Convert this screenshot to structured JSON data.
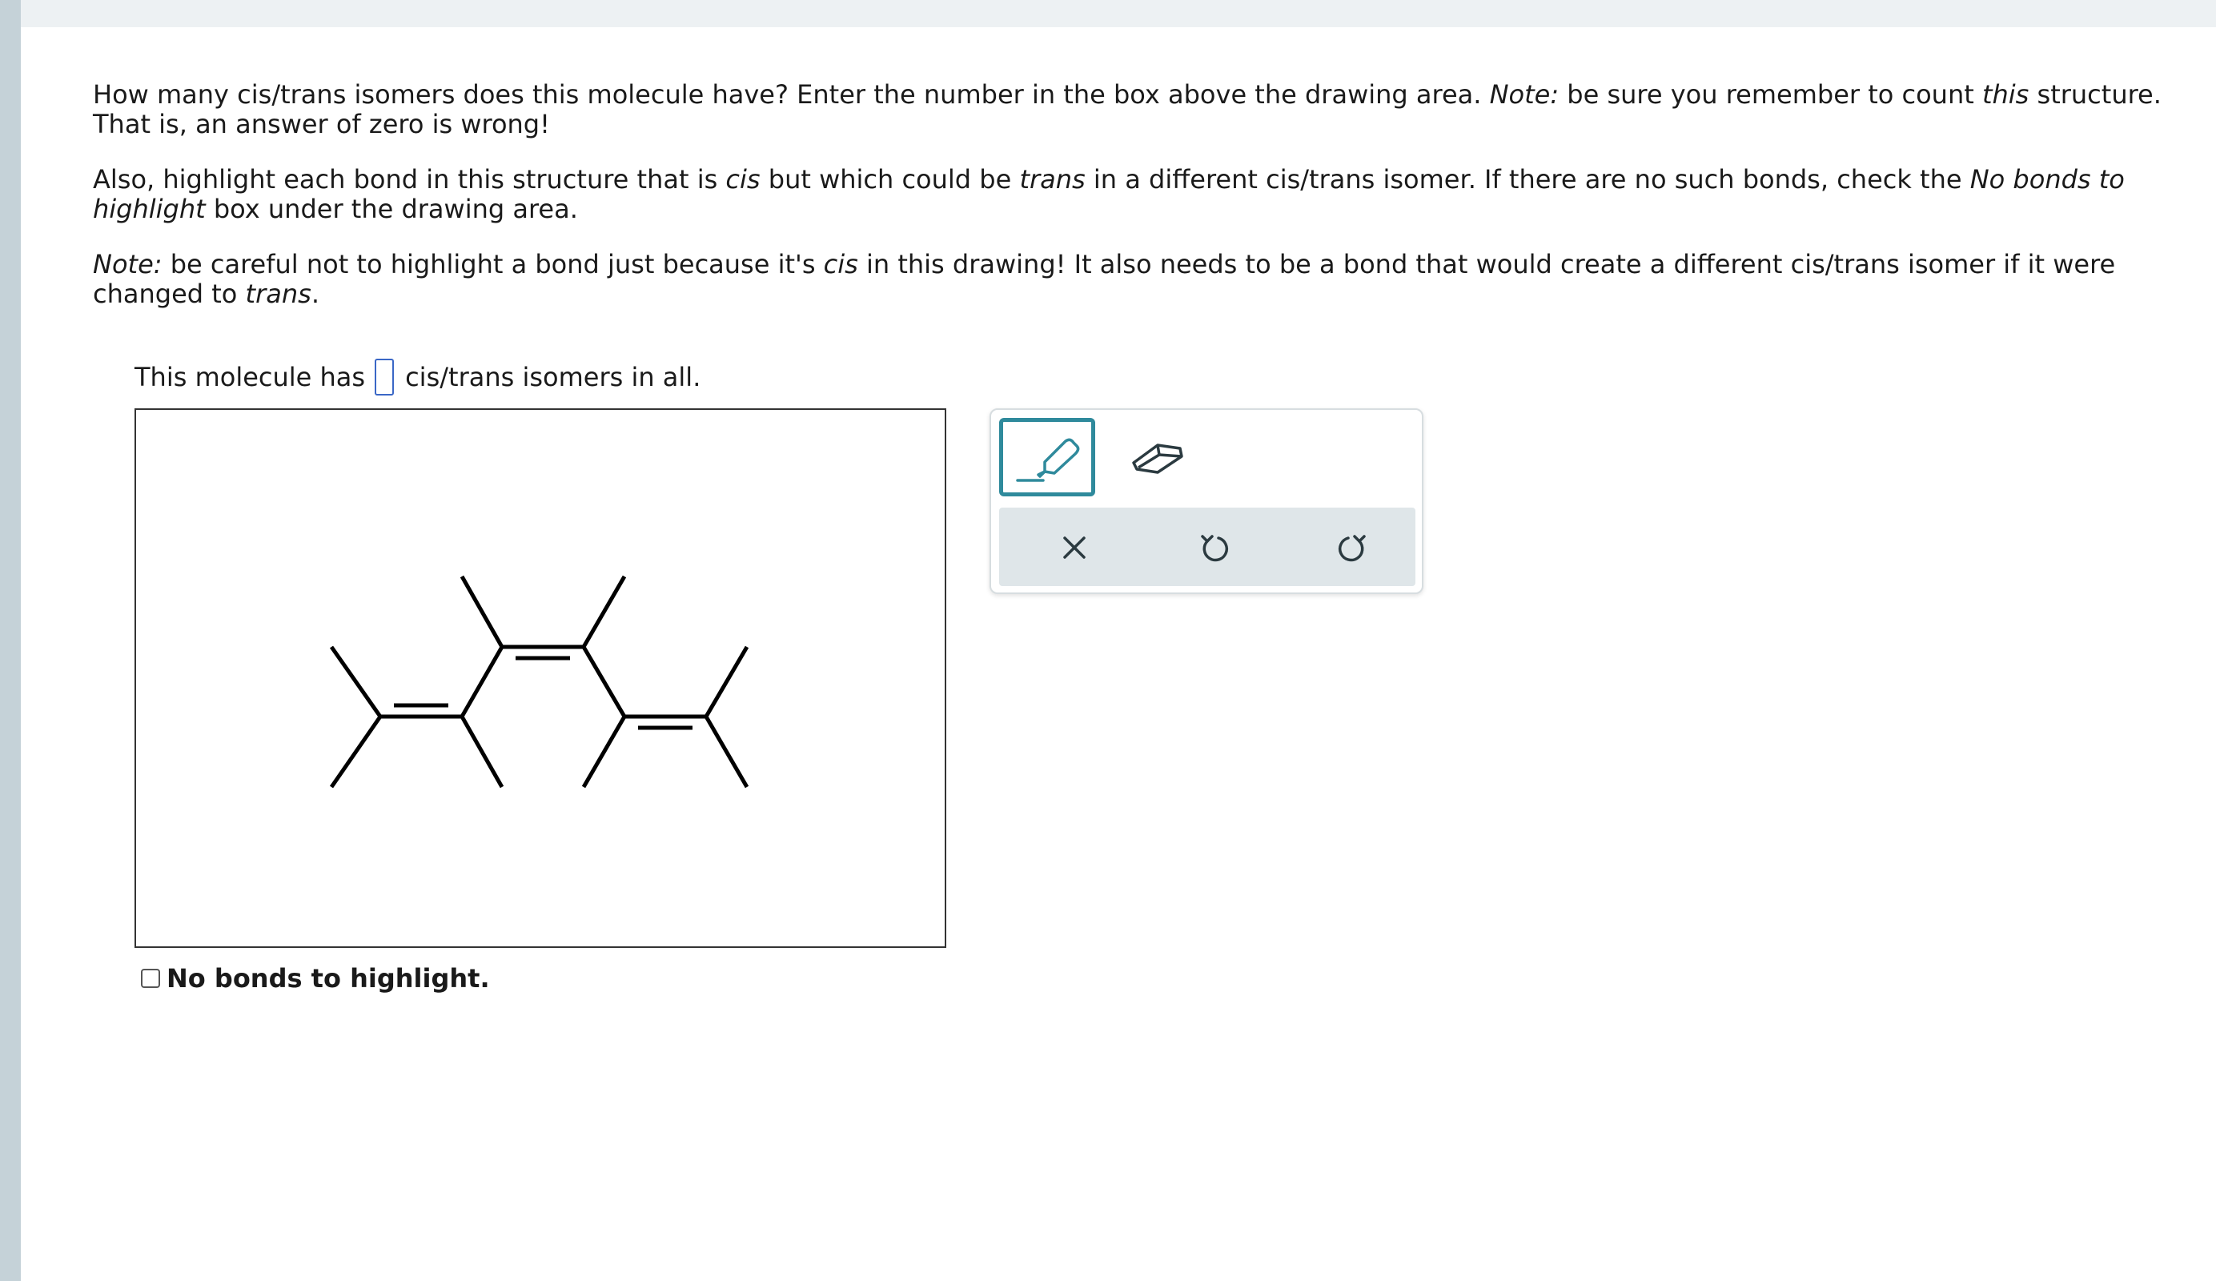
{
  "question": {
    "p1": {
      "a": "How many cis/trans isomers does this molecule have? Enter the number in the box above the drawing area. ",
      "note": "Note:",
      "b": " be sure you remember to count ",
      "this": "this",
      "c": " structure. That is, an answer of zero is wrong!"
    },
    "p2": {
      "a": "Also, highlight each bond in this structure that is ",
      "cis": "cis",
      "b": " but which could be ",
      "trans": "trans",
      "c": " in a different cis/trans isomer. If there are no such bonds, check the ",
      "nobonds": "No bonds to highlight",
      "d": " box under the drawing area."
    },
    "p3": {
      "note": "Note:",
      "a": " be careful not to highlight a bond just because it's ",
      "cis": "cis",
      "b": " in this drawing! It also needs to be a bond that would create a different cis/trans isomer if it were changed to ",
      "trans": "trans",
      "c": "."
    }
  },
  "answer": {
    "prefix": "This molecule has",
    "suffix": "cis/trans isomers in all.",
    "value": ""
  },
  "no_bonds_label": "No bonds to highlight.",
  "toolbar": {
    "tools": [
      "pencil-icon",
      "eraser-icon"
    ],
    "actions": [
      "close-icon",
      "undo-icon",
      "redo-icon"
    ],
    "accent": "#2f8a9c"
  }
}
